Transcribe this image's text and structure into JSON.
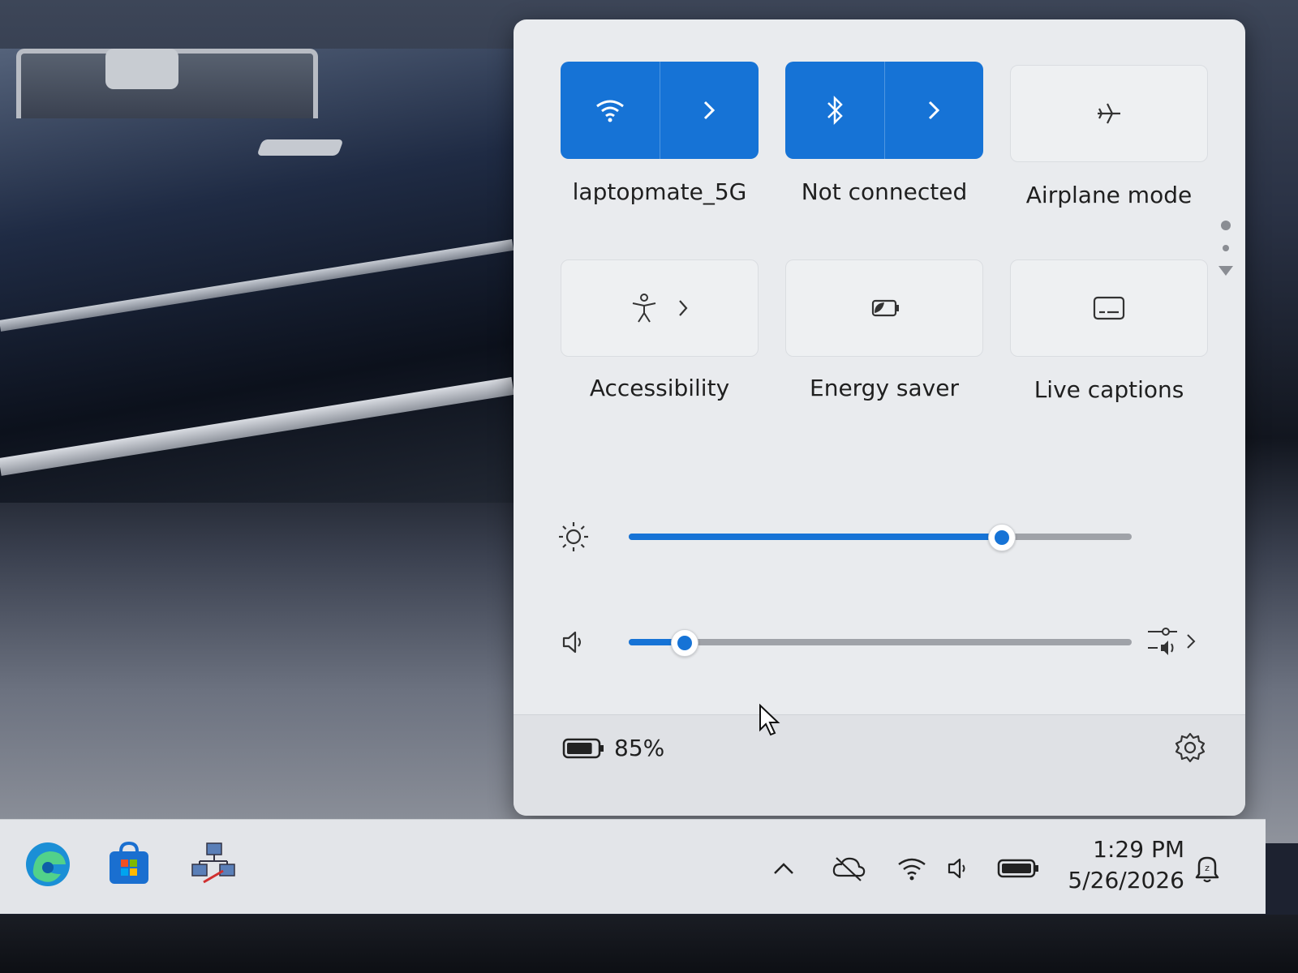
{
  "colors": {
    "accent": "#1673d6",
    "panel": "#e9ebee",
    "taskbar": "#e3e5e9"
  },
  "tiles": {
    "wifi": {
      "label": "laptopmate_5G",
      "icon": "wifi-icon",
      "state": "on"
    },
    "bluetooth": {
      "label": "Not connected",
      "icon": "bluetooth-icon",
      "state": "on"
    },
    "airplane": {
      "label": "Airplane mode",
      "icon": "airplane-icon",
      "state": "off"
    },
    "accessibility": {
      "label": "Accessibility",
      "icon": "accessibility-icon",
      "state": "off"
    },
    "energy": {
      "label": "Energy saver",
      "icon": "energy-saver-icon",
      "state": "off"
    },
    "captions": {
      "label": "Live captions",
      "icon": "live-captions-icon",
      "state": "off"
    }
  },
  "sliders": {
    "brightness": {
      "icon": "brightness-icon",
      "level": 0.74
    },
    "volume": {
      "icon": "speaker-icon",
      "level": 0.11
    }
  },
  "footer": {
    "battery": "85%",
    "battery_level": 0.85,
    "settings_icon": "gear-icon"
  },
  "taskbar": {
    "apps": [
      "edge-icon",
      "store-icon",
      "network-app-icon"
    ],
    "tray": [
      "chevron-up-icon",
      "sync-off-icon",
      "wifi-icon",
      "speaker-icon",
      "battery-icon"
    ],
    "time": "1:29 PM",
    "date": "5/26/2026",
    "notifications_icon": "notification-bell-icon"
  }
}
